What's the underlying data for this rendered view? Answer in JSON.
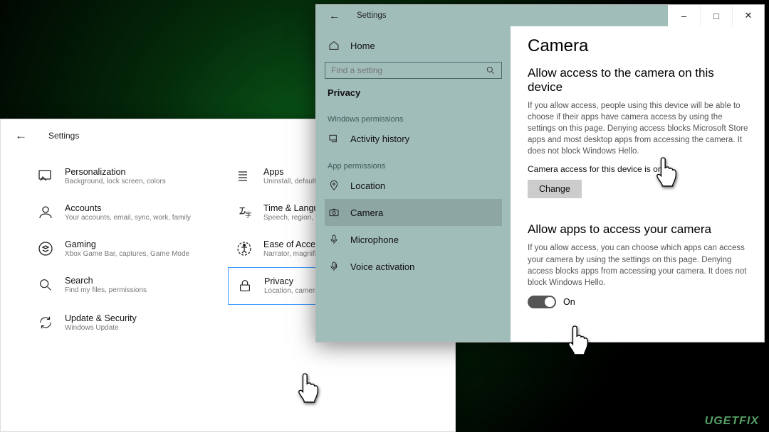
{
  "bgwin": {
    "title": "Settings",
    "categories": [
      {
        "title": "Personalization",
        "sub": "Background, lock screen, colors"
      },
      {
        "title": "Apps",
        "sub": "Uninstall, defaults, optional features"
      },
      {
        "title": "Accounts",
        "sub": "Your accounts, email, sync, work, family"
      },
      {
        "title": "Time & Language",
        "sub": "Speech, region, date"
      },
      {
        "title": "Gaming",
        "sub": "Xbox Game Bar, captures, Game Mode"
      },
      {
        "title": "Ease of Access",
        "sub": "Narrator, magnifier, high contrast"
      },
      {
        "title": "Search",
        "sub": "Find my files, permissions"
      },
      {
        "title": "Privacy",
        "sub": "Location, camera, microphone"
      },
      {
        "title": "Update & Security",
        "sub": "Windows Update"
      }
    ]
  },
  "fgwin": {
    "title": "Settings",
    "sidebar": {
      "home": "Home",
      "search_placeholder": "Find a setting",
      "section": "Privacy",
      "group1": "Windows permissions",
      "group1_items": [
        "Activity history"
      ],
      "group2": "App permissions",
      "group2_items": [
        "Location",
        "Camera",
        "Microphone",
        "Voice activation"
      ]
    },
    "content": {
      "h1": "Camera",
      "h2a": "Allow access to the camera on this device",
      "p1": "If you allow access, people using this device will be able to choose if their apps have camera access by using the settings on this page. Denying access blocks Microsoft Store apps and most desktop apps from accessing the camera. It does not block Windows Hello.",
      "status": "Camera access for this device is on",
      "change": "Change",
      "h2b": "Allow apps to access your camera",
      "p2": "If you allow access, you can choose which apps can access your camera by using the settings on this page. Denying access blocks apps from accessing your camera. It does not block Windows Hello.",
      "toggle_label": "On"
    }
  },
  "watermark": "UGETFIX"
}
